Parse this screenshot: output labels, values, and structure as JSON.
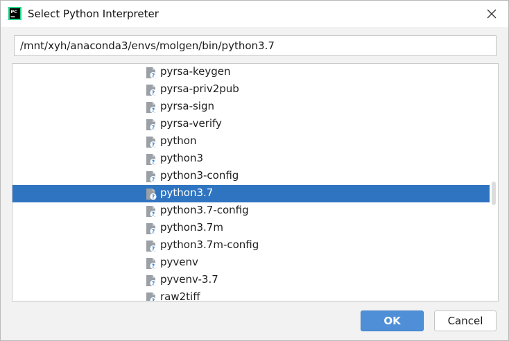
{
  "window": {
    "title": "Select Python Interpreter",
    "icon": "pycharm-app-icon",
    "close_icon": "close-icon"
  },
  "path_field": {
    "value": "/mnt/xyh/anaconda3/envs/molgen/bin/python3.7"
  },
  "tree": {
    "selected_index": 7,
    "file_icon": "unknown-file-icon",
    "items": [
      {
        "label": "pyrsa-keygen"
      },
      {
        "label": "pyrsa-priv2pub"
      },
      {
        "label": "pyrsa-sign"
      },
      {
        "label": "pyrsa-verify"
      },
      {
        "label": "python"
      },
      {
        "label": "python3"
      },
      {
        "label": "python3-config"
      },
      {
        "label": "python3.7"
      },
      {
        "label": "python3.7-config"
      },
      {
        "label": "python3.7m"
      },
      {
        "label": "python3.7m-config"
      },
      {
        "label": "pyvenv"
      },
      {
        "label": "pyvenv-3.7"
      },
      {
        "label": "raw2tiff"
      }
    ]
  },
  "buttons": {
    "ok": "OK",
    "cancel": "Cancel"
  },
  "colors": {
    "selection": "#2f74c0",
    "ok_button": "#4f8fd8"
  }
}
